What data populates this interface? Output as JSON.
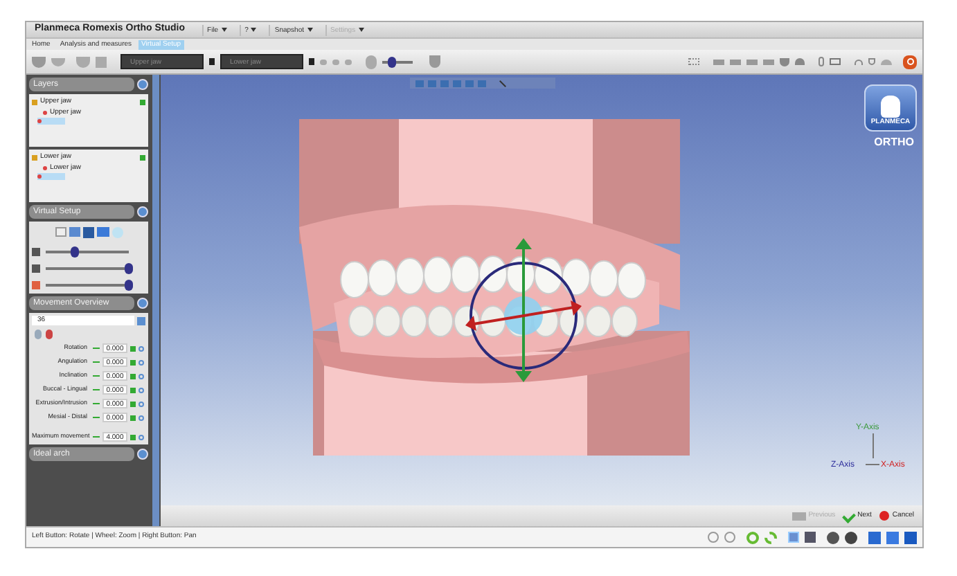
{
  "window": {
    "title": "Planmeca Romexis Ortho Studio"
  },
  "menu": [
    {
      "label": "File",
      "disabled": false
    },
    {
      "label": "?",
      "disabled": false
    },
    {
      "label": "Snapshot",
      "disabled": false
    },
    {
      "label": "Settings",
      "disabled": true
    }
  ],
  "tabs": [
    {
      "label": "Home",
      "selected": false
    },
    {
      "label": "Analysis and measures",
      "selected": false
    },
    {
      "label": "Virtual Setup",
      "selected": true
    }
  ],
  "toolbar": {
    "upper_jaw": {
      "placeholder": "Upper jaw"
    },
    "lower_jaw": {
      "placeholder": "Lower jaw"
    },
    "slider": {
      "level": 0.3
    }
  },
  "layers": {
    "title": "Layers",
    "groups": [
      {
        "label": "Upper jaw",
        "children": [
          {
            "label": "Upper jaw",
            "selected": false
          },
          {
            "selected": true
          }
        ]
      },
      {
        "label": "Lower jaw",
        "children": [
          {
            "label": "Lower jaw",
            "selected": false
          },
          {
            "selected": true
          }
        ]
      }
    ]
  },
  "virtual_setup": {
    "title": "Virtual Setup",
    "sliders": [
      {
        "level": 0.35
      },
      {
        "level": 1.0
      },
      {
        "level": 1.0
      }
    ]
  },
  "movement_overview": {
    "title": "Movement Overview",
    "tooth": "36",
    "rows": [
      {
        "label": "Rotation",
        "value": "0.000"
      },
      {
        "label": "Angulation",
        "value": "0.000"
      },
      {
        "label": "Inclination",
        "value": "0.000"
      },
      {
        "label": "Buccal - Lingual",
        "value": "0.000"
      },
      {
        "label": "Extrusion/Intrusion",
        "value": "0.000"
      },
      {
        "label": "Mesial - Distal",
        "value": "0.000"
      }
    ],
    "maximum": {
      "label": "Maximum movement",
      "value": "4.000"
    }
  },
  "ideal_arch": {
    "title": "Ideal arch"
  },
  "viewport": {
    "logo": {
      "brand": "PLANMECA",
      "product": "ORTHO"
    },
    "axes": {
      "y": "Y-Axis",
      "z": "Z-Axis",
      "x": "X-Axis"
    }
  },
  "wizard": [
    {
      "kind": "previous",
      "label": "Previous",
      "disabled": true
    },
    {
      "kind": "next",
      "label": "Next",
      "disabled": false
    },
    {
      "kind": "cancel",
      "label": "Cancel",
      "disabled": false
    }
  ],
  "status_bar": {
    "text": "Left Button: Rotate | Wheel: Zoom | Right Button: Pan"
  }
}
